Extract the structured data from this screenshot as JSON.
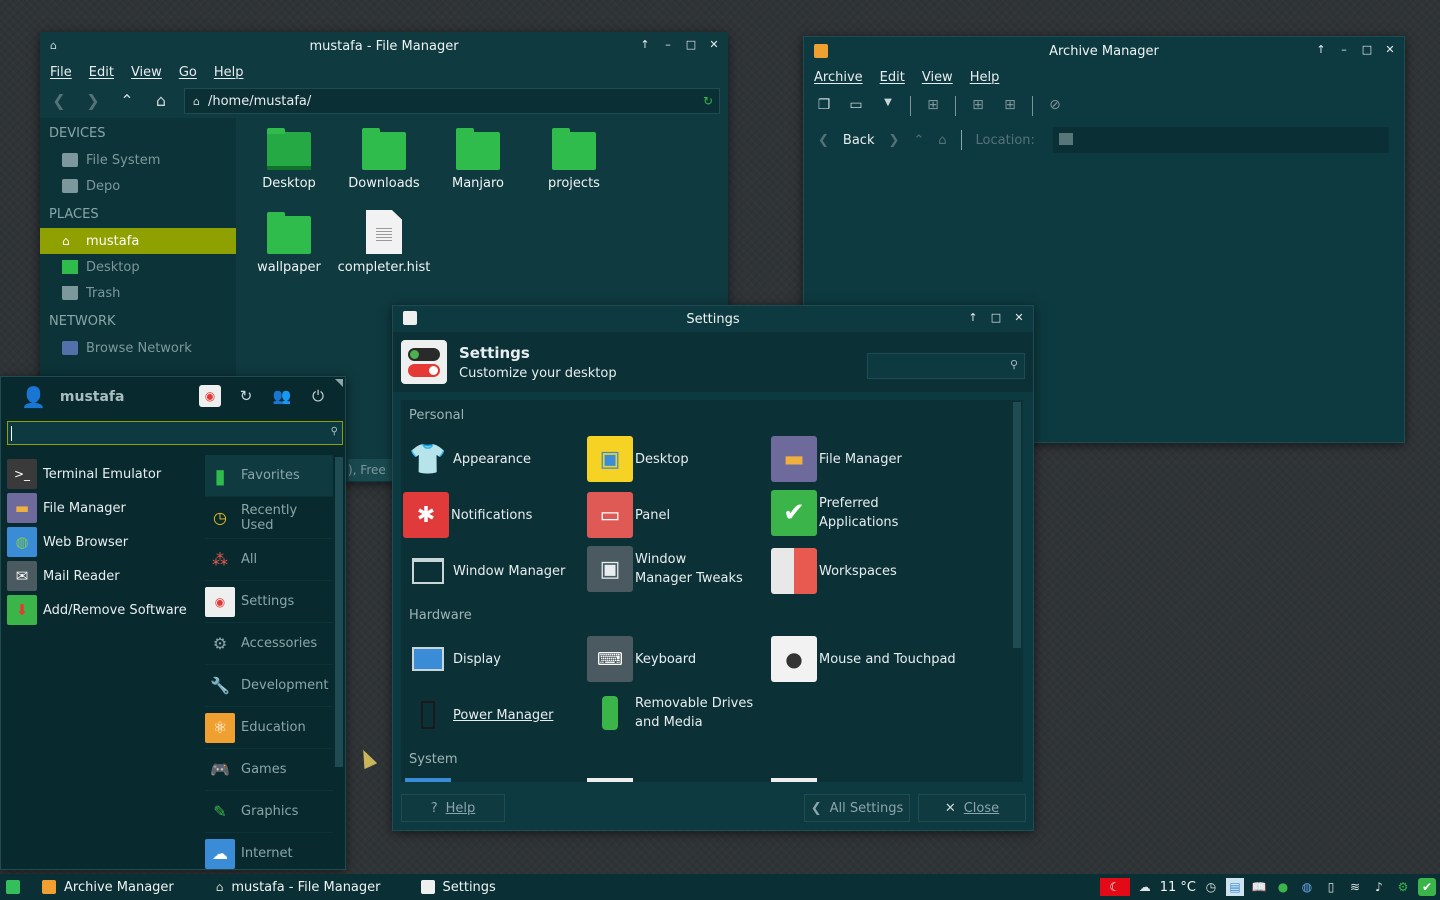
{
  "file_manager": {
    "title": "mustafa - File Manager",
    "menu": [
      "File",
      "Edit",
      "View",
      "Go",
      "Help"
    ],
    "path": "/home/mustafa/",
    "sidebar": {
      "devices_head": "DEVICES",
      "devices": [
        "File System",
        "Depo"
      ],
      "places_head": "PLACES",
      "places": [
        "mustafa",
        "Desktop",
        "Trash"
      ],
      "network_head": "NETWORK",
      "network": [
        "Browse Network"
      ]
    },
    "files": [
      "Desktop",
      "Downloads",
      "Manjaro",
      "projects",
      "wallpaper",
      "completer.hist"
    ],
    "status_fragment": "), Free"
  },
  "archive_manager": {
    "title": "Archive Manager",
    "menu": [
      "Archive",
      "Edit",
      "View",
      "Help"
    ],
    "back_label": "Back",
    "location_label": "Location:"
  },
  "settings": {
    "title": "Settings",
    "header_title": "Settings",
    "header_subtitle": "Customize your desktop",
    "categories": [
      "Personal",
      "Hardware",
      "System"
    ],
    "personal": [
      "Appearance",
      "Desktop",
      "File Manager",
      "Notifications",
      "Panel",
      "Preferred Applications",
      "Window Manager",
      "Window Manager Tweaks",
      "Workspaces"
    ],
    "hardware": [
      "Display",
      "Keyboard",
      "Mouse and Touchpad",
      "Power Manager",
      "Removable Drives and Media"
    ],
    "help_label": "Help",
    "all_settings_label": "All Settings",
    "close_label": "Close"
  },
  "menu": {
    "username": "mustafa",
    "favorites": [
      "Terminal Emulator",
      "File Manager",
      "Web Browser",
      "Mail Reader",
      "Add/Remove Software"
    ],
    "categories": [
      "Favorites",
      "Recently Used",
      "All",
      "Settings",
      "Accessories",
      "Development",
      "Education",
      "Games",
      "Graphics",
      "Internet"
    ]
  },
  "taskbar": {
    "tasks": [
      "Archive Manager",
      "mustafa - File Manager",
      "Settings"
    ],
    "weather": "11 °C"
  },
  "colors": {
    "accent": "#8ea101",
    "window_bg": "#0d3a40",
    "folder_green": "#2fbc4d"
  }
}
